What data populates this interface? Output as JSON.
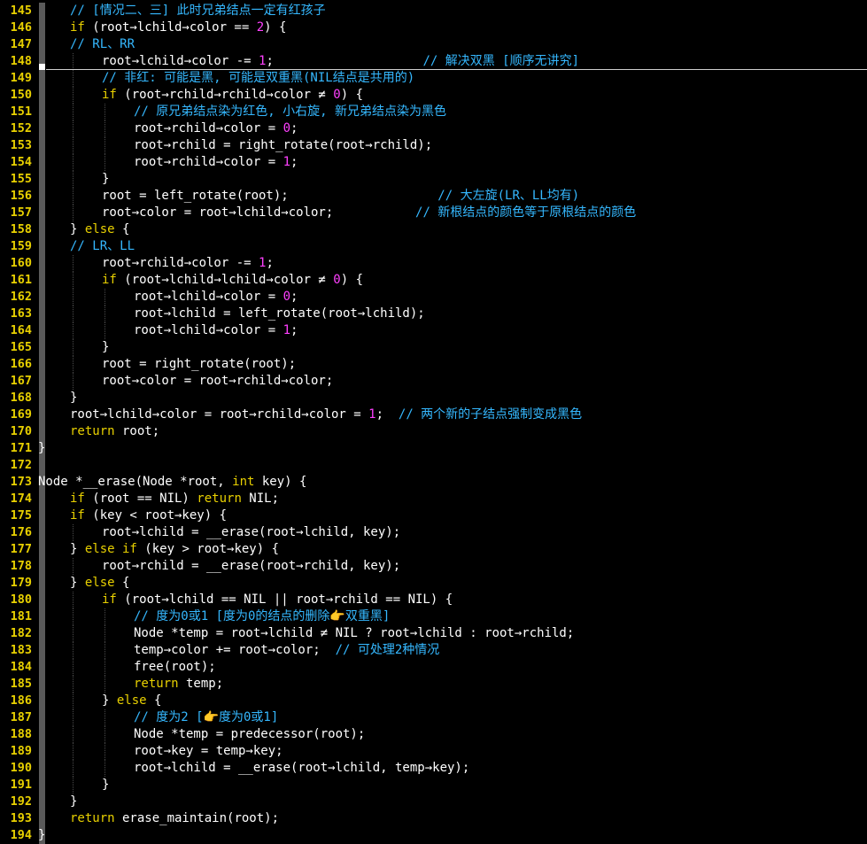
{
  "editor": {
    "colors": {
      "line_number": "#e8d000",
      "keyword": "#e8d000",
      "number": "#ff40ff",
      "comment": "#35b8ff",
      "text": "#ffffff",
      "background": "#000000"
    },
    "cursor_line": 148,
    "lines": [
      {
        "n": "145",
        "indent": 1,
        "t": [
          {
            "c": "// [情况二、三] 此时兄弟结点一定有红孩子",
            "k": "cmt"
          }
        ]
      },
      {
        "n": "146",
        "indent": 1,
        "t": [
          {
            "c": "if",
            "k": "kw"
          },
          {
            "c": " (root→lchild→color == "
          },
          {
            "c": "2",
            "k": "num"
          },
          {
            "c": ") {"
          }
        ]
      },
      {
        "n": "147",
        "indent": 1,
        "t": [
          {
            "c": "// RL、RR",
            "k": "cmt"
          }
        ]
      },
      {
        "n": "148",
        "indent": 2,
        "t": [
          {
            "c": "root→lchild→color -= "
          },
          {
            "c": "1",
            "k": "num"
          },
          {
            "c": ";                    "
          },
          {
            "c": "// 解决双黑 [顺序无讲究]",
            "k": "cmt"
          }
        ]
      },
      {
        "n": "149",
        "indent": 2,
        "t": [
          {
            "c": "// 非红: 可能是黑, 可能是双重黑(NIL结点是共用的)",
            "k": "cmt"
          }
        ]
      },
      {
        "n": "150",
        "indent": 2,
        "t": [
          {
            "c": "if",
            "k": "kw"
          },
          {
            "c": " (root→rchild→rchild→color ≠ "
          },
          {
            "c": "0",
            "k": "num"
          },
          {
            "c": ") {"
          }
        ]
      },
      {
        "n": "151",
        "indent": 3,
        "t": [
          {
            "c": "// 原兄弟结点染为红色, 小右旋, 新兄弟结点染为黑色",
            "k": "cmt"
          }
        ]
      },
      {
        "n": "152",
        "indent": 3,
        "t": [
          {
            "c": "root→rchild→color = "
          },
          {
            "c": "0",
            "k": "num"
          },
          {
            "c": ";"
          }
        ]
      },
      {
        "n": "153",
        "indent": 3,
        "t": [
          {
            "c": "root→rchild = right_rotate(root→rchild);"
          }
        ]
      },
      {
        "n": "154",
        "indent": 3,
        "t": [
          {
            "c": "root→rchild→color = "
          },
          {
            "c": "1",
            "k": "num"
          },
          {
            "c": ";"
          }
        ]
      },
      {
        "n": "155",
        "indent": 2,
        "t": [
          {
            "c": "}"
          }
        ]
      },
      {
        "n": "156",
        "indent": 2,
        "t": [
          {
            "c": "root = left_rotate(root);                    "
          },
          {
            "c": "// 大左旋(LR、LL均有)",
            "k": "cmt"
          }
        ]
      },
      {
        "n": "157",
        "indent": 2,
        "t": [
          {
            "c": "root→color = root→lchild→color;           "
          },
          {
            "c": "// 新根结点的颜色等于原根结点的颜色",
            "k": "cmt"
          }
        ]
      },
      {
        "n": "158",
        "indent": 1,
        "t": [
          {
            "c": "} "
          },
          {
            "c": "else",
            "k": "kw"
          },
          {
            "c": " {"
          }
        ]
      },
      {
        "n": "159",
        "indent": 1,
        "t": [
          {
            "c": "// LR、LL",
            "k": "cmt"
          }
        ]
      },
      {
        "n": "160",
        "indent": 2,
        "t": [
          {
            "c": "root→rchild→color -= "
          },
          {
            "c": "1",
            "k": "num"
          },
          {
            "c": ";"
          }
        ]
      },
      {
        "n": "161",
        "indent": 2,
        "t": [
          {
            "c": "if",
            "k": "kw"
          },
          {
            "c": " (root→lchild→lchild→color ≠ "
          },
          {
            "c": "0",
            "k": "num"
          },
          {
            "c": ") {"
          }
        ]
      },
      {
        "n": "162",
        "indent": 3,
        "t": [
          {
            "c": "root→lchild→color = "
          },
          {
            "c": "0",
            "k": "num"
          },
          {
            "c": ";"
          }
        ]
      },
      {
        "n": "163",
        "indent": 3,
        "t": [
          {
            "c": "root→lchild = left_rotate(root→lchild);"
          }
        ]
      },
      {
        "n": "164",
        "indent": 3,
        "t": [
          {
            "c": "root→lchild→color = "
          },
          {
            "c": "1",
            "k": "num"
          },
          {
            "c": ";"
          }
        ]
      },
      {
        "n": "165",
        "indent": 2,
        "t": [
          {
            "c": "}"
          }
        ]
      },
      {
        "n": "166",
        "indent": 2,
        "t": [
          {
            "c": "root = right_rotate(root);"
          }
        ]
      },
      {
        "n": "167",
        "indent": 2,
        "t": [
          {
            "c": "root→color = root→rchild→color;"
          }
        ]
      },
      {
        "n": "168",
        "indent": 1,
        "t": [
          {
            "c": "}"
          }
        ]
      },
      {
        "n": "169",
        "indent": 1,
        "t": [
          {
            "c": "root→lchild→color = root→rchild→color = "
          },
          {
            "c": "1",
            "k": "num"
          },
          {
            "c": ";  "
          },
          {
            "c": "// 两个新的子结点强制变成黑色",
            "k": "cmt"
          }
        ]
      },
      {
        "n": "170",
        "indent": 1,
        "t": [
          {
            "c": "return",
            "k": "kw"
          },
          {
            "c": " root;"
          }
        ]
      },
      {
        "n": "171",
        "indent": 0,
        "t": [
          {
            "c": "}"
          }
        ]
      },
      {
        "n": "172",
        "indent": 0,
        "t": []
      },
      {
        "n": "173",
        "indent": 0,
        "t": [
          {
            "c": "Node *__erase(Node *root, "
          },
          {
            "c": "int",
            "k": "kw"
          },
          {
            "c": " key) {"
          }
        ]
      },
      {
        "n": "174",
        "indent": 1,
        "t": [
          {
            "c": "if",
            "k": "kw"
          },
          {
            "c": " (root == NIL) "
          },
          {
            "c": "return",
            "k": "kw"
          },
          {
            "c": " NIL;"
          }
        ]
      },
      {
        "n": "175",
        "indent": 1,
        "t": [
          {
            "c": "if",
            "k": "kw"
          },
          {
            "c": " (key < root→key) {"
          }
        ]
      },
      {
        "n": "176",
        "indent": 2,
        "t": [
          {
            "c": "root→lchild = __erase(root→lchild, key);"
          }
        ]
      },
      {
        "n": "177",
        "indent": 1,
        "t": [
          {
            "c": "} "
          },
          {
            "c": "else if",
            "k": "kw"
          },
          {
            "c": " (key > root→key) {"
          }
        ]
      },
      {
        "n": "178",
        "indent": 2,
        "t": [
          {
            "c": "root→rchild = __erase(root→rchild, key);"
          }
        ]
      },
      {
        "n": "179",
        "indent": 1,
        "t": [
          {
            "c": "} "
          },
          {
            "c": "else",
            "k": "kw"
          },
          {
            "c": " {"
          }
        ]
      },
      {
        "n": "180",
        "indent": 2,
        "t": [
          {
            "c": "if",
            "k": "kw"
          },
          {
            "c": " (root→lchild == NIL || root→rchild == NIL) {"
          }
        ]
      },
      {
        "n": "181",
        "indent": 3,
        "t": [
          {
            "c": "// 度为0或1 [度为0的结点的删除👉双重黑]",
            "k": "cmt"
          }
        ]
      },
      {
        "n": "182",
        "indent": 3,
        "t": [
          {
            "c": "Node *temp = root→lchild ≠ NIL ? root→lchild : root→rchild;"
          }
        ]
      },
      {
        "n": "183",
        "indent": 3,
        "t": [
          {
            "c": "temp→color += root→color;  "
          },
          {
            "c": "// 可处理2种情况",
            "k": "cmt"
          }
        ]
      },
      {
        "n": "184",
        "indent": 3,
        "t": [
          {
            "c": "free(root);"
          }
        ]
      },
      {
        "n": "185",
        "indent": 3,
        "t": [
          {
            "c": "return",
            "k": "kw"
          },
          {
            "c": " temp;"
          }
        ]
      },
      {
        "n": "186",
        "indent": 2,
        "t": [
          {
            "c": "} "
          },
          {
            "c": "else",
            "k": "kw"
          },
          {
            "c": " {"
          }
        ]
      },
      {
        "n": "187",
        "indent": 3,
        "t": [
          {
            "c": "// 度为2 [👉度为0或1]",
            "k": "cmt"
          }
        ]
      },
      {
        "n": "188",
        "indent": 3,
        "t": [
          {
            "c": "Node *temp = predecessor(root);"
          }
        ]
      },
      {
        "n": "189",
        "indent": 3,
        "t": [
          {
            "c": "root→key = temp→key;"
          }
        ]
      },
      {
        "n": "190",
        "indent": 3,
        "t": [
          {
            "c": "root→lchild = __erase(root→lchild, temp→key);"
          }
        ]
      },
      {
        "n": "191",
        "indent": 2,
        "t": [
          {
            "c": "}"
          }
        ]
      },
      {
        "n": "192",
        "indent": 1,
        "t": [
          {
            "c": "}"
          }
        ]
      },
      {
        "n": "193",
        "indent": 1,
        "t": [
          {
            "c": "return",
            "k": "kw"
          },
          {
            "c": " erase_maintain(root);"
          }
        ]
      },
      {
        "n": "194",
        "indent": 0,
        "t": [
          {
            "c": "}"
          }
        ]
      }
    ]
  }
}
